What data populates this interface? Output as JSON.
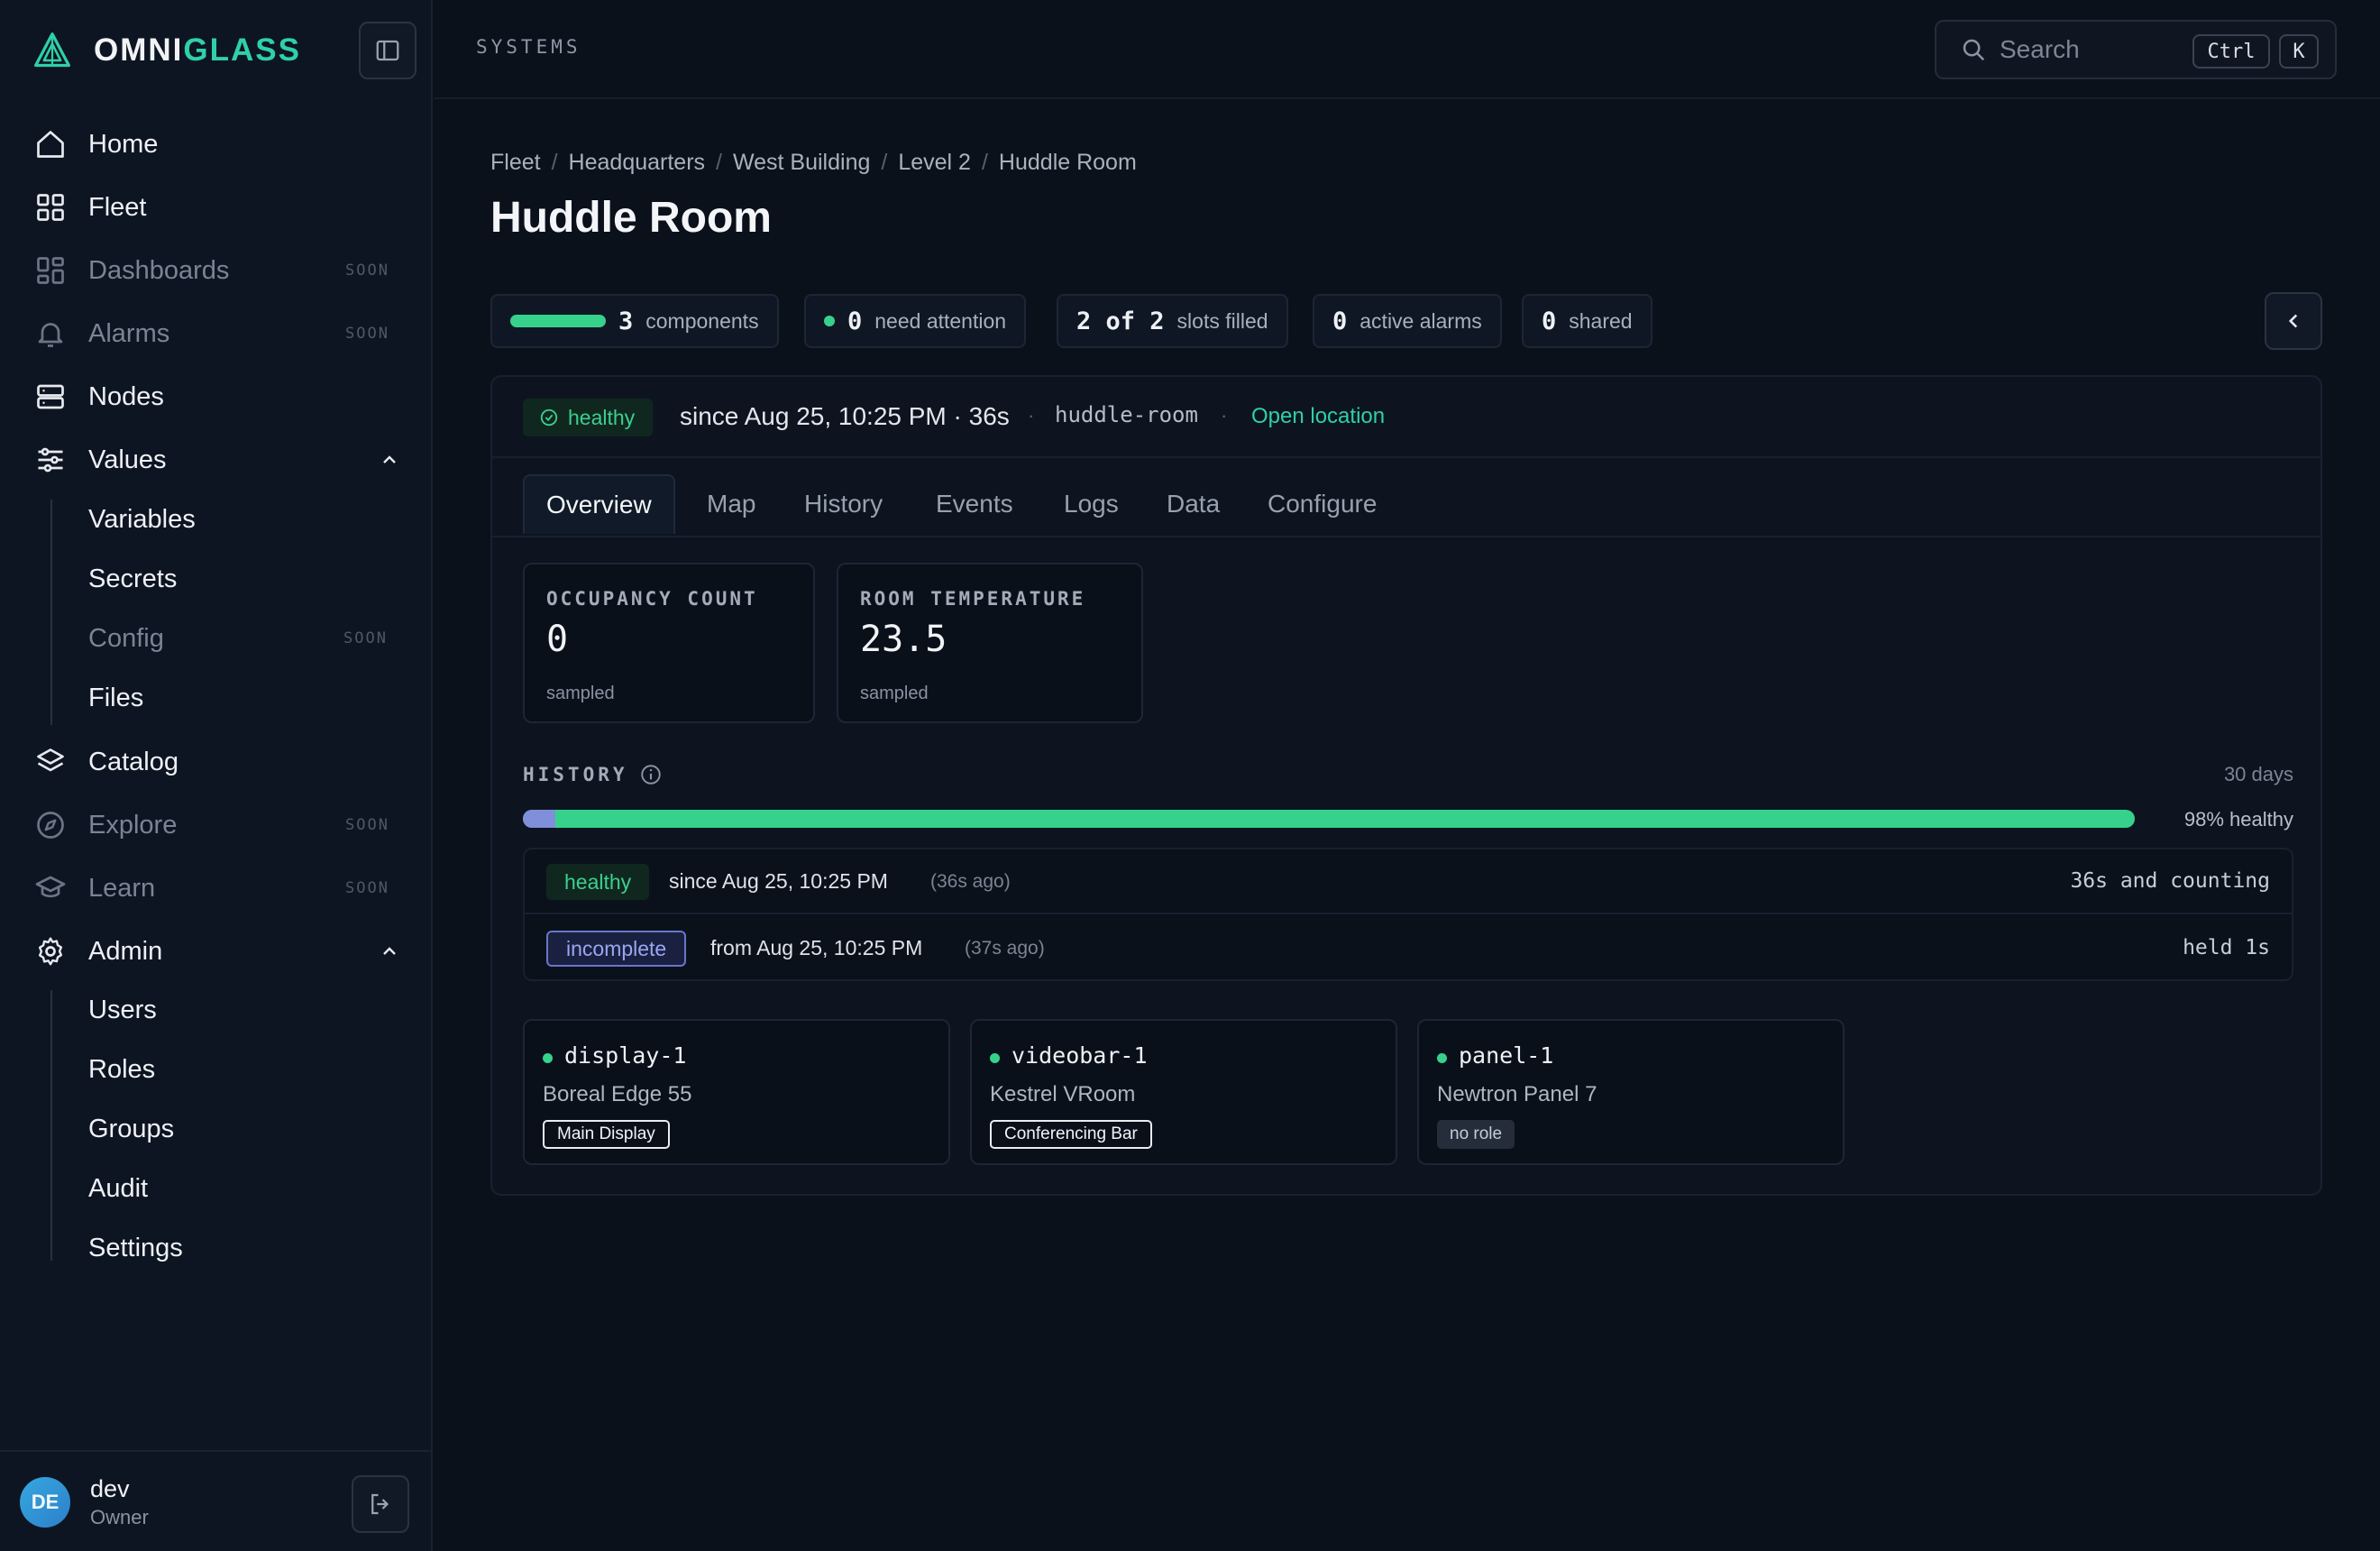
{
  "brand": {
    "name_a": "OMNI",
    "name_b": "GLASS"
  },
  "nav": {
    "home": "Home",
    "fleet": "Fleet",
    "dashboards": "Dashboards",
    "alarms": "Alarms",
    "nodes": "Nodes",
    "values": "Values",
    "variables": "Variables",
    "secrets": "Secrets",
    "config": "Config",
    "files": "Files",
    "catalog": "Catalog",
    "explore": "Explore",
    "learn": "Learn",
    "admin": "Admin",
    "users": "Users",
    "roles": "Roles",
    "groups": "Groups",
    "audit": "Audit",
    "settings": "Settings",
    "soon": "SOON"
  },
  "user": {
    "initials": "DE",
    "name": "dev",
    "role": "Owner"
  },
  "header": {
    "section": "SYSTEMS",
    "search_placeholder": "Search",
    "kbd_ctrl": "Ctrl",
    "kbd_k": "K"
  },
  "breadcrumbs": [
    "Fleet",
    "Headquarters",
    "West Building",
    "Level 2",
    "Huddle Room"
  ],
  "page_title": "Huddle Room",
  "summary": {
    "components_count": "3",
    "components_label": "components",
    "attention_count": "0",
    "attention_label": "need attention",
    "slots_value": "2 of 2",
    "slots_label": "slots filled",
    "alarms_count": "0",
    "alarms_label": "active alarms",
    "shared_count": "0",
    "shared_label": "shared"
  },
  "status": {
    "state": "healthy",
    "since": "since Aug 25, 10:25 PM · 36s",
    "slug": "huddle-room",
    "open_location": "Open location",
    "separator": "·"
  },
  "tabs": [
    "Overview",
    "Map",
    "History",
    "Events",
    "Logs",
    "Data",
    "Configure"
  ],
  "metrics": [
    {
      "label": "OCCUPANCY COUNT",
      "value": "0",
      "sub": "sampled"
    },
    {
      "label": "ROOM TEMPERATURE",
      "value": "23.5",
      "sub": "sampled"
    }
  ],
  "history": {
    "label": "HISTORY",
    "range": "30 days",
    "healthy_pct_label": "98% healthy",
    "healthy_fraction": 0.98,
    "rows": [
      {
        "state": "healthy",
        "text": "since Aug 25, 10:25 PM",
        "ago": "(36s ago)",
        "duration": "36s and counting"
      },
      {
        "state": "incomplete",
        "text": "from Aug 25, 10:25 PM",
        "ago": "(37s ago)",
        "duration": "held 1s"
      }
    ]
  },
  "components": [
    {
      "name": "display-1",
      "model": "Boreal Edge 55",
      "role": "Main Display"
    },
    {
      "name": "videobar-1",
      "model": "Kestrel VRoom",
      "role": "Conferencing Bar"
    },
    {
      "name": "panel-1",
      "model": "Newtron Panel 7",
      "role": "no role"
    }
  ],
  "colors": {
    "accent": "#2fd0a8",
    "healthy": "#36d28c",
    "incomplete": "#7f8fd9"
  }
}
